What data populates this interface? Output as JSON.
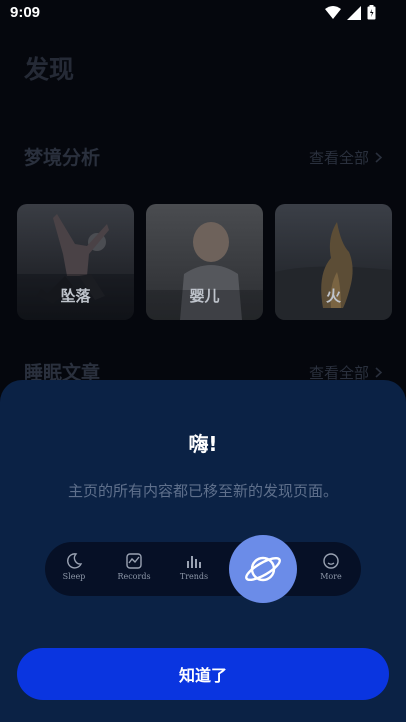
{
  "status_bar": {
    "time": "9:09"
  },
  "page": {
    "title": "发现",
    "dream_section": {
      "title": "梦境分析",
      "see_all": "查看全部"
    },
    "dream_cards": [
      {
        "label": "坠落"
      },
      {
        "label": "婴儿"
      },
      {
        "label": "火"
      }
    ],
    "articles_section": {
      "title": "睡眠文章",
      "see_all": "查看全部"
    }
  },
  "sheet": {
    "title": "嗨!",
    "description": "主页的所有内容都已移至新的发现页面。",
    "tabs": [
      {
        "label": "Sleep",
        "icon": "moon-icon"
      },
      {
        "label": "Records",
        "icon": "records-icon"
      },
      {
        "label": "Trends",
        "icon": "bar-chart-icon"
      },
      {
        "label": "More",
        "icon": "smiley-icon"
      }
    ],
    "fab_icon": "planet-icon",
    "confirm_label": "知道了"
  },
  "colors": {
    "sheet_bg": "#0b2245",
    "accent": "#0a35e0",
    "fab": "#6b8ce8"
  }
}
